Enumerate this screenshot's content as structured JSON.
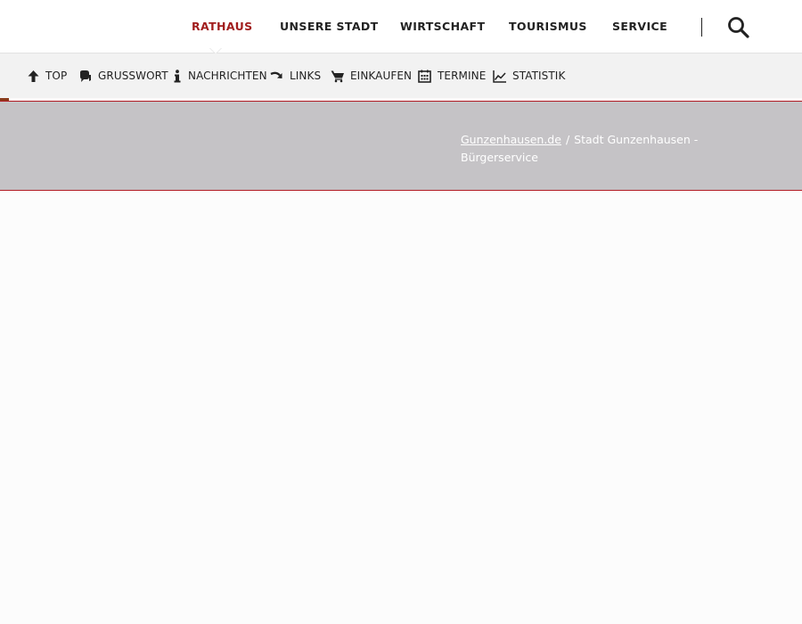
{
  "main_nav": {
    "items": [
      {
        "label": "RATHAUS",
        "active": true
      },
      {
        "label": "UNSERE STADT",
        "active": false
      },
      {
        "label": "WIRTSCHAFT",
        "active": false
      },
      {
        "label": "TOURISMUS",
        "active": false
      },
      {
        "label": "SERVICE",
        "active": false
      }
    ],
    "search_icon": "search-icon",
    "active_color": "#a11d1d"
  },
  "sub_nav": {
    "items": [
      {
        "label": "TOP",
        "icon": "arrow-up-icon"
      },
      {
        "label": "GRUSSWORT",
        "icon": "speech-bubble-icon"
      },
      {
        "label": "NACHRICHTEN",
        "icon": "info-icon"
      },
      {
        "label": "LINKS",
        "icon": "redirect-arrow-icon"
      },
      {
        "label": "EINKAUFEN",
        "icon": "shopping-cart-icon"
      },
      {
        "label": "TERMINE",
        "icon": "calendar-icon"
      },
      {
        "label": "STATISTIK",
        "icon": "chart-line-icon"
      }
    ]
  },
  "breadcrumb": {
    "home_link": "Gunzenhausen.de",
    "separator": "/",
    "current": "Stadt Gunzenhausen - Bürgerservice"
  },
  "colors": {
    "accent": "#a11d1d",
    "hero_bg": "#c5c3c6",
    "hero_border": "#b11c24"
  }
}
